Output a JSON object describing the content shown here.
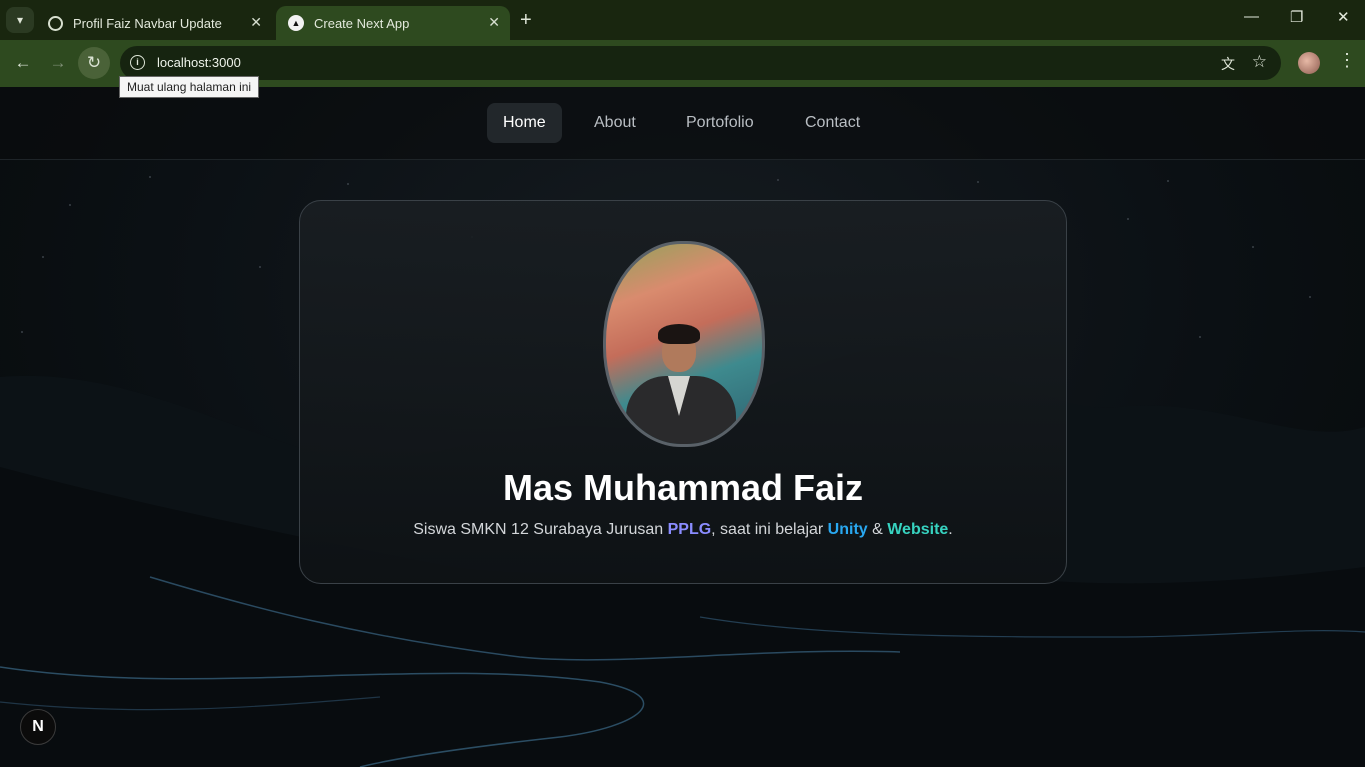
{
  "browser": {
    "tabs": [
      {
        "title": "Profil Faiz Navbar Update",
        "active": false
      },
      {
        "title": "Create Next App",
        "active": true
      }
    ],
    "url": "localhost:3000",
    "tooltip": "Muat ulang halaman ini"
  },
  "nav": {
    "items": [
      {
        "label": "Home",
        "active": true
      },
      {
        "label": "About",
        "active": false
      },
      {
        "label": "Portofolio",
        "active": false
      },
      {
        "label": "Contact",
        "active": false
      }
    ]
  },
  "profile": {
    "name": "Mas Muhammad Faiz",
    "bio_prefix": "Siswa SMKN 12 Surabaya Jurusan ",
    "bio_major": "PPLG",
    "bio_mid": ", saat ini belajar ",
    "bio_skill1": "Unity",
    "bio_and": " & ",
    "bio_skill2": "Website",
    "bio_end": "."
  },
  "badge": {
    "label": "N"
  },
  "colors": {
    "pplg": "#8a8cff",
    "unity": "#29a8f0",
    "website": "#37d3c0"
  }
}
